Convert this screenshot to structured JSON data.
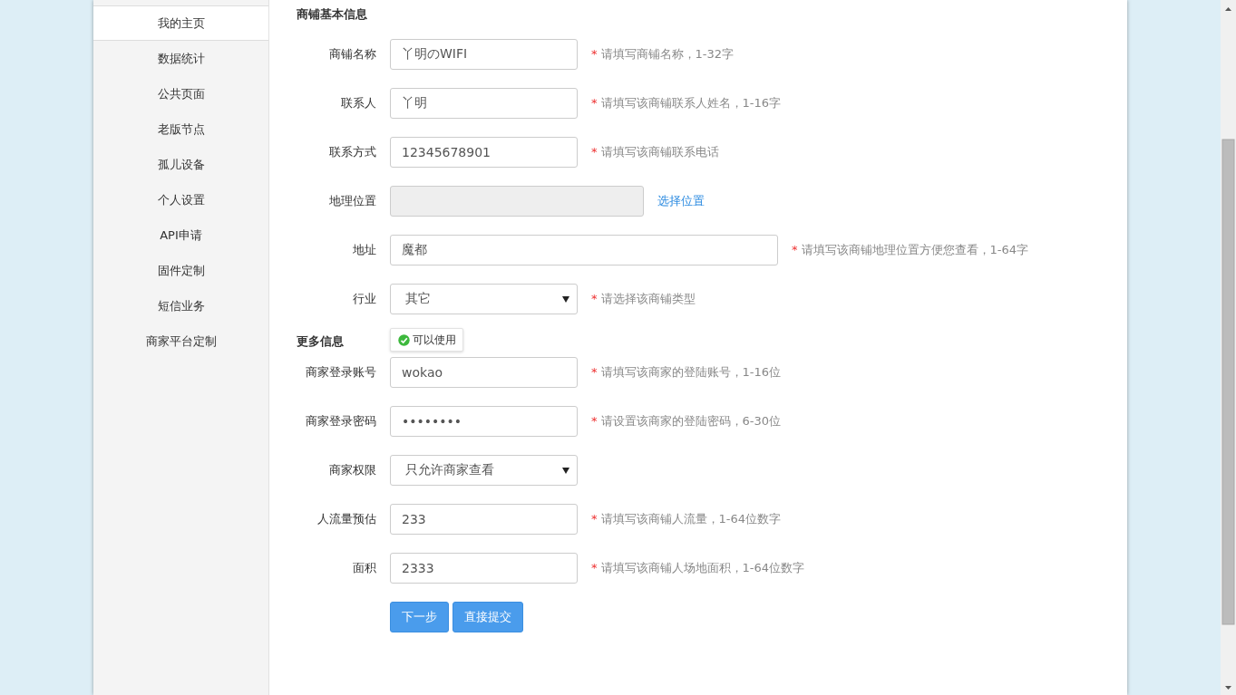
{
  "sidebar": {
    "items": [
      {
        "label": "我的主页",
        "selected": true
      },
      {
        "label": "数据统计",
        "selected": false
      },
      {
        "label": "公共页面",
        "selected": false
      },
      {
        "label": "老版节点",
        "selected": false
      },
      {
        "label": "孤儿设备",
        "selected": false
      },
      {
        "label": "个人设置",
        "selected": false
      },
      {
        "label": "API申请",
        "selected": false
      },
      {
        "label": "固件定制",
        "selected": false
      },
      {
        "label": "短信业务",
        "selected": false
      },
      {
        "label": "商家平台定制",
        "selected": false
      }
    ]
  },
  "sections": [
    {
      "title": "商铺基本信息",
      "fields": [
        {
          "kind": "text",
          "label": "商铺名称",
          "value": "丫明のWIFI",
          "hint": {
            "mark": "*",
            "text": "请填写商铺名称，1-32字"
          }
        },
        {
          "kind": "text",
          "label": "联系人",
          "value": "丫明",
          "hint": {
            "mark": "*",
            "text": "请填写该商铺联系人姓名，1-16字"
          }
        },
        {
          "kind": "text",
          "label": "联系方式",
          "value": "12345678901",
          "hint": {
            "mark": "*",
            "text": "请填写该商铺联系电话"
          }
        },
        {
          "kind": "disabled",
          "label": "地理位置",
          "link": "选择位置"
        },
        {
          "kind": "longtext",
          "label": "地址",
          "value": "魔都",
          "hint": {
            "mark": "*",
            "text": "请填写该商铺地理位置方便您查看，1-64字"
          }
        },
        {
          "kind": "select",
          "label": "行业",
          "value": "其它",
          "hint": {
            "mark": "*",
            "text": "请选择该商铺类型"
          }
        }
      ]
    },
    {
      "title": "更多信息",
      "fields": [
        {
          "kind": "text",
          "label": "商家登录账号",
          "value": "wokao",
          "tooltip": "可以使用",
          "hint": {
            "mark": "*",
            "text": "请填写该商家的登陆账号，1-16位"
          }
        },
        {
          "kind": "password",
          "label": "商家登录密码",
          "value": "••••••••",
          "hint": {
            "mark": "*",
            "text": "请设置该商家的登陆密码，6-30位"
          }
        },
        {
          "kind": "select",
          "label": "商家权限",
          "value": "只允许商家查看"
        },
        {
          "kind": "text",
          "label": "人流量预估",
          "value": "233",
          "hint": {
            "mark": "*",
            "text": "请填写该商铺人流量，1-64位数字"
          }
        },
        {
          "kind": "text",
          "label": "面积",
          "value": "2333",
          "hint": {
            "mark": "*",
            "text": "请填写该商铺人场地面积，1-64位数字"
          }
        }
      ]
    }
  ],
  "buttons": [
    "下一步",
    "直接提交"
  ]
}
